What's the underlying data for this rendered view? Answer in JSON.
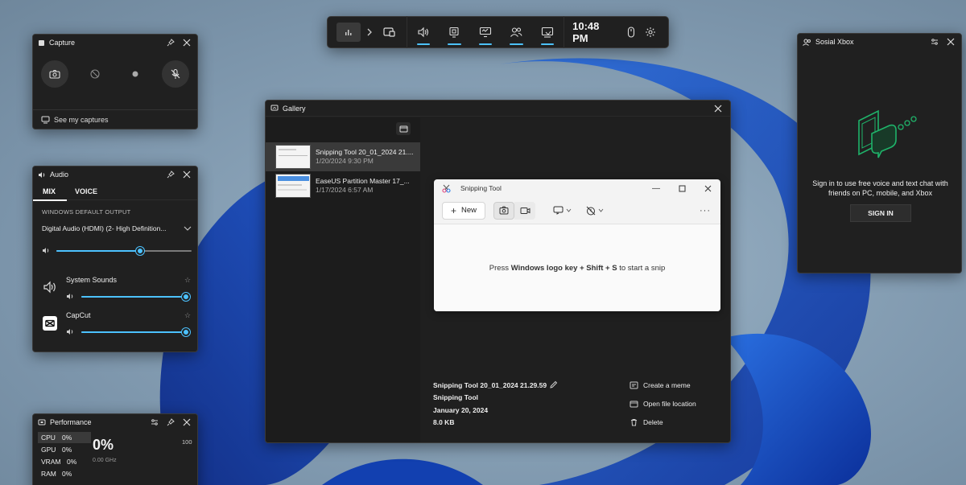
{
  "topbar": {
    "time": "10:48 PM",
    "items": [
      "widget-menu",
      "capture",
      "audio",
      "performance",
      "resources",
      "xbox-social",
      "gallery"
    ]
  },
  "capture": {
    "title": "Capture",
    "see_captures": "See my captures"
  },
  "audio": {
    "title": "Audio",
    "tabs": [
      "MIX",
      "VOICE"
    ],
    "section_label": "WINDOWS DEFAULT OUTPUT",
    "device": "Digital Audio (HDMI) (2- High Definition...",
    "master_volume": 0.62,
    "apps": [
      {
        "name": "System Sounds",
        "volume": 1.0
      },
      {
        "name": "CapCut",
        "volume": 1.0
      }
    ]
  },
  "performance": {
    "title": "Performance",
    "rows": [
      {
        "label": "CPU",
        "value": "0%"
      },
      {
        "label": "GPU",
        "value": "0%"
      },
      {
        "label": "VRAM",
        "value": "0%"
      },
      {
        "label": "RAM",
        "value": "0%"
      }
    ],
    "big_value": "0%",
    "sub_value": "0.00 GHz",
    "max": "100"
  },
  "gallery": {
    "title": "Gallery",
    "items": [
      {
        "name": "Snipping Tool 20_01_2024 21....",
        "date": "1/20/2024 9:30 PM",
        "selected": true
      },
      {
        "name": "EaseUS Partition Master 17_...",
        "date": "1/17/2024 6:57 AM",
        "selected": false
      }
    ],
    "preview": {
      "app_title": "Snipping Tool",
      "new_label": "New",
      "hint_pre": "Press ",
      "hint_bold": "Windows logo key + Shift + S",
      "hint_post": " to start a snip"
    },
    "details": {
      "filename": "Snipping Tool 20_01_2024 21.29.59",
      "app": "Snipping Tool",
      "date": "January 20, 2024",
      "size": "8.0 KB"
    },
    "actions": [
      "Create a meme",
      "Open file location",
      "Delete"
    ]
  },
  "xbox": {
    "title": "Sosial Xbox",
    "message": "Sign in to use free voice and text chat with friends on PC, mobile, and Xbox",
    "sign_in": "SIGN IN"
  },
  "colors": {
    "accent": "#4cc2ff",
    "panel": "#202020"
  }
}
